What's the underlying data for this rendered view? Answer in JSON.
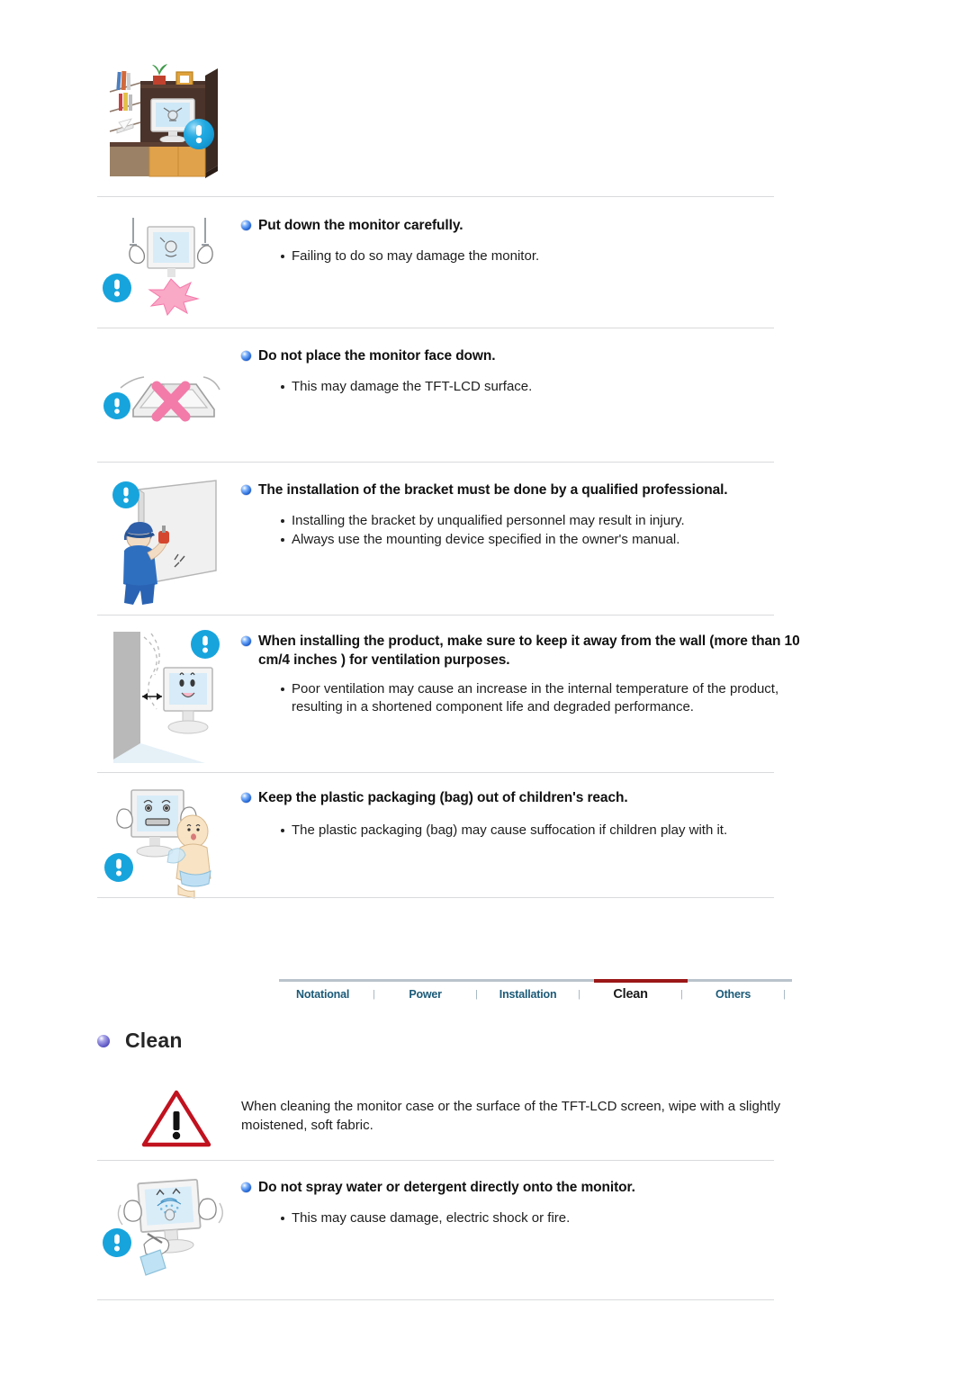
{
  "document": {
    "type": "monitor-user-manual-safety-page",
    "section_title": "Clean",
    "tab_bar": {
      "tabs": [
        {
          "label": "Notational",
          "active": false
        },
        {
          "label": "Power",
          "active": false
        },
        {
          "label": "Installation",
          "active": false
        },
        {
          "label": "Clean",
          "active": true
        },
        {
          "label": "Others",
          "active": false
        }
      ],
      "separator": "|",
      "active_underline_color": "#9b1717",
      "tab_color": "#1b5a78",
      "active_tab_color": "#1a1a1a",
      "rule_color": "#b9c3cb"
    },
    "installation_items": [
      {
        "illustration": "monitor-on-bookshelf-illustration",
        "heading": "",
        "bullets": []
      },
      {
        "illustration": "put-down-monitor-illustration",
        "heading": "Put down the monitor carefully.",
        "bullets": [
          "Failing to do so may damage the monitor."
        ]
      },
      {
        "illustration": "monitor-face-down-illustration",
        "heading": "Do not place the monitor face down.",
        "bullets": [
          "This may damage the TFT-LCD surface."
        ]
      },
      {
        "illustration": "bracket-installation-illustration",
        "heading": "The installation of the bracket must be done by a qualified professional.",
        "bullets": [
          "Installing the bracket by unqualified personnel may result in injury.",
          "Always use the mounting device specified in the owner's manual."
        ]
      },
      {
        "illustration": "wall-clearance-illustration",
        "heading": "When installing the product, make sure to keep it away from the wall (more than 10 cm/4 inches ) for ventilation purposes.",
        "bullets": [
          "Poor ventilation may cause an increase in the internal temperature of the product, resulting in a shortened component life and degraded performance."
        ]
      },
      {
        "illustration": "plastic-bag-child-illustration",
        "heading": "Keep the plastic packaging (bag) out of children's reach.",
        "bullets": [
          "The plastic packaging (bag) may cause suffocation if children play with it."
        ]
      }
    ],
    "clean_section": {
      "heading": "Clean",
      "notice": {
        "icon": "warning-triangle-icon",
        "text": "When cleaning the monitor case or the surface of the TFT-LCD screen, wipe with a slightly moistened, soft fabric."
      },
      "items": [
        {
          "illustration": "spray-water-on-monitor-illustration",
          "heading": "Do not spray water or detergent directly onto the monitor.",
          "bullets": [
            "This may cause damage, electric shock or fire."
          ]
        }
      ]
    },
    "colors": {
      "heading_bullet": "#1b5fd0",
      "clean_bullet": "#5b55c4",
      "rule": "#d9dadc",
      "warning_red": "#c1121f",
      "exclaim_blue": "#17a4dd"
    }
  }
}
